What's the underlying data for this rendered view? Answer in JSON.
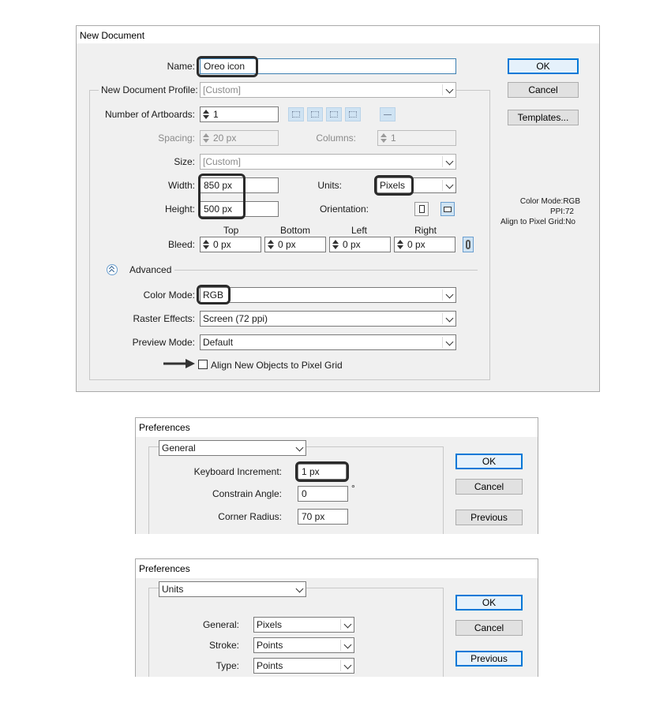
{
  "new_document": {
    "title": "New Document",
    "name_label": "Name:",
    "name_value": "Oreo icon",
    "profile_label": "New Document Profile:",
    "profile_value": "[Custom]",
    "artboards_label": "Number of Artboards:",
    "artboards_value": "1",
    "spacing_label": "Spacing:",
    "spacing_value": "20 px",
    "columns_label": "Columns:",
    "columns_value": "1",
    "size_label": "Size:",
    "size_value": "[Custom]",
    "width_label": "Width:",
    "width_value": "850 px",
    "height_label": "Height:",
    "height_value": "500 px",
    "units_label": "Units:",
    "units_value": "Pixels",
    "orientation_label": "Orientation:",
    "bleed_label": "Bleed:",
    "bleed_top_label": "Top",
    "bleed_bottom_label": "Bottom",
    "bleed_left_label": "Left",
    "bleed_right_label": "Right",
    "bleed_top": "0 px",
    "bleed_bottom": "0 px",
    "bleed_left": "0 px",
    "bleed_right": "0 px",
    "advanced_label": "Advanced",
    "color_mode_label": "Color Mode:",
    "color_mode_value": "RGB",
    "raster_label": "Raster Effects:",
    "raster_value": "Screen (72 ppi)",
    "preview_label": "Preview Mode:",
    "preview_value": "Default",
    "align_label": "Align New Objects to Pixel Grid",
    "ok": "OK",
    "cancel": "Cancel",
    "templates": "Templates...",
    "info_color_mode": "Color Mode:RGB",
    "info_ppi": "PPI:72",
    "info_align": "Align to Pixel Grid:No"
  },
  "prefs_general": {
    "title": "Preferences",
    "section": "General",
    "keyboard_label": "Keyboard Increment:",
    "keyboard_value": "1 px",
    "constrain_label": "Constrain Angle:",
    "constrain_value": "0",
    "degree": "°",
    "corner_label": "Corner Radius:",
    "corner_value": "70 px",
    "ok": "OK",
    "cancel": "Cancel",
    "previous": "Previous"
  },
  "prefs_units": {
    "title": "Preferences",
    "section": "Units",
    "general_label": "General:",
    "general_value": "Pixels",
    "stroke_label": "Stroke:",
    "stroke_value": "Points",
    "type_label": "Type:",
    "type_value": "Points",
    "ok": "OK",
    "cancel": "Cancel",
    "previous": "Previous"
  },
  "colors": {
    "highlight_border": "#2b2b2b",
    "default_button": "#0078d7",
    "dialog_bg": "#f0f0f0"
  }
}
